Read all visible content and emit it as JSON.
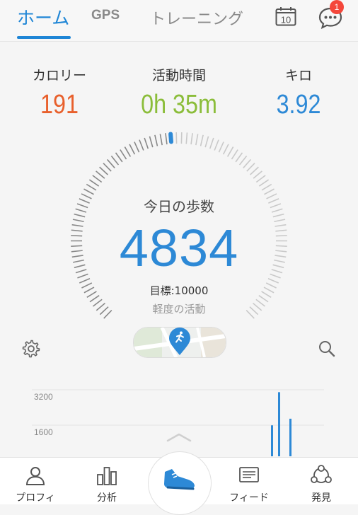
{
  "tabs": [
    {
      "label": "ホーム",
      "active": true
    },
    {
      "label": "GPS",
      "active": false
    },
    {
      "label": "トレーニング",
      "active": false
    }
  ],
  "calendar_day": "10",
  "chat_badge": "1",
  "stats": {
    "calories": {
      "label": "カロリー",
      "value": "191",
      "color": "#e8602c"
    },
    "active_time": {
      "label": "活動時間",
      "value": "0h 35m",
      "color": "#8bbd3a"
    },
    "distance": {
      "label": "キロ",
      "value": "3.92",
      "color": "#2d89d6"
    }
  },
  "progress": {
    "title": "今日の歩数",
    "steps": "4834",
    "goal_text": "目標:10000",
    "level": "軽度の活動",
    "fraction": 0.4834
  },
  "chart_data": {
    "type": "bar",
    "yticks": [
      "3200",
      "1600"
    ],
    "values": [
      1400,
      2900,
      1700
    ]
  },
  "bottom_nav": [
    {
      "label": "プロフィ",
      "icon": "profile-icon"
    },
    {
      "label": "分析",
      "icon": "analysis-icon"
    },
    {
      "label": "",
      "icon": "shoe-icon"
    },
    {
      "label": "フィード",
      "icon": "feed-icon"
    },
    {
      "label": "発見",
      "icon": "discover-icon"
    }
  ],
  "colors": {
    "accent": "#1f86d6",
    "badge": "#f4473b"
  }
}
